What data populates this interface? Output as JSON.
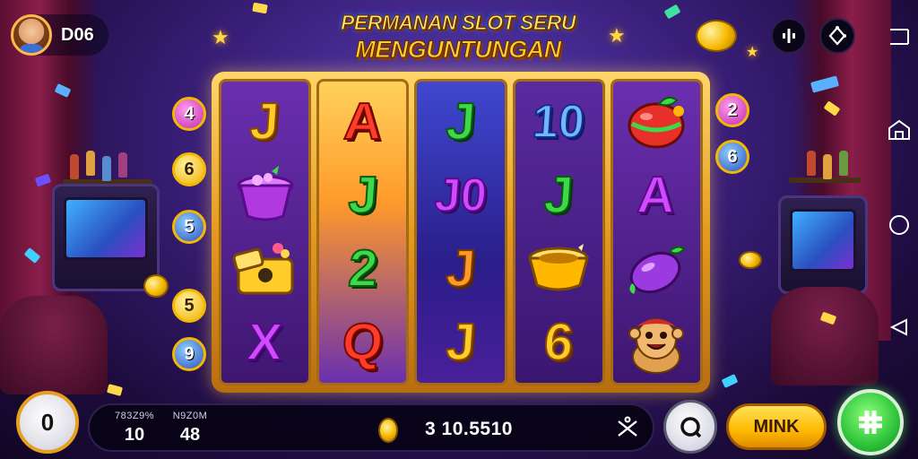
{
  "player": {
    "name": "D06",
    "avatar_icon": "player-avatar"
  },
  "title": {
    "line1": "PERMANAN SLOT SERU",
    "line2": "MENGUNTUNGAN"
  },
  "top_controls": [
    {
      "icon": "sound-bars-icon"
    },
    {
      "icon": "settings-gear-icon"
    }
  ],
  "system_nav": [
    {
      "icon": "minimize-icon"
    },
    {
      "icon": "home-icon"
    },
    {
      "icon": "circle-home-icon"
    },
    {
      "icon": "back-triangle-icon"
    }
  ],
  "paylines": {
    "left": [
      "4",
      "6",
      "5",
      "5",
      "9"
    ],
    "right": [
      "2",
      "6"
    ]
  },
  "reels": [
    [
      {
        "text": "J",
        "style": "gold"
      },
      {
        "text": "",
        "icon": "purple-gem-pot-icon"
      },
      {
        "text": "",
        "icon": "gold-chest-icon"
      },
      {
        "text": "X",
        "style": "purple"
      }
    ],
    [
      {
        "text": "A",
        "style": "red"
      },
      {
        "text": "J",
        "style": "green"
      },
      {
        "text": "2",
        "style": "green"
      },
      {
        "text": "Q",
        "style": "red"
      }
    ],
    [
      {
        "text": "J",
        "style": "green"
      },
      {
        "text": "J0",
        "style": "purple"
      },
      {
        "text": "J",
        "style": "orange"
      },
      {
        "text": "J",
        "style": "gold"
      }
    ],
    [
      {
        "text": "10",
        "style": "blue"
      },
      {
        "text": "J",
        "style": "green"
      },
      {
        "text": "",
        "icon": "gold-pot-icon"
      },
      {
        "text": "6",
        "style": "gold"
      }
    ],
    [
      {
        "text": "",
        "icon": "red-fruit-icon"
      },
      {
        "text": "A",
        "style": "purple"
      },
      {
        "text": "",
        "icon": "purple-plum-icon"
      },
      {
        "text": "",
        "icon": "smiling-mascot-icon"
      }
    ]
  ],
  "bottom": {
    "bet_button": "0",
    "stat1": {
      "label": "783Z9%",
      "value": "10"
    },
    "stat2": {
      "label": "N9Z0M",
      "value": "48"
    },
    "balance": "3 10.5510",
    "max_label": "MINK"
  },
  "colors": {
    "accent_gold": "#ffcc2a",
    "spin_green": "#2ec43a",
    "background_purple": "#3a1f7a"
  }
}
